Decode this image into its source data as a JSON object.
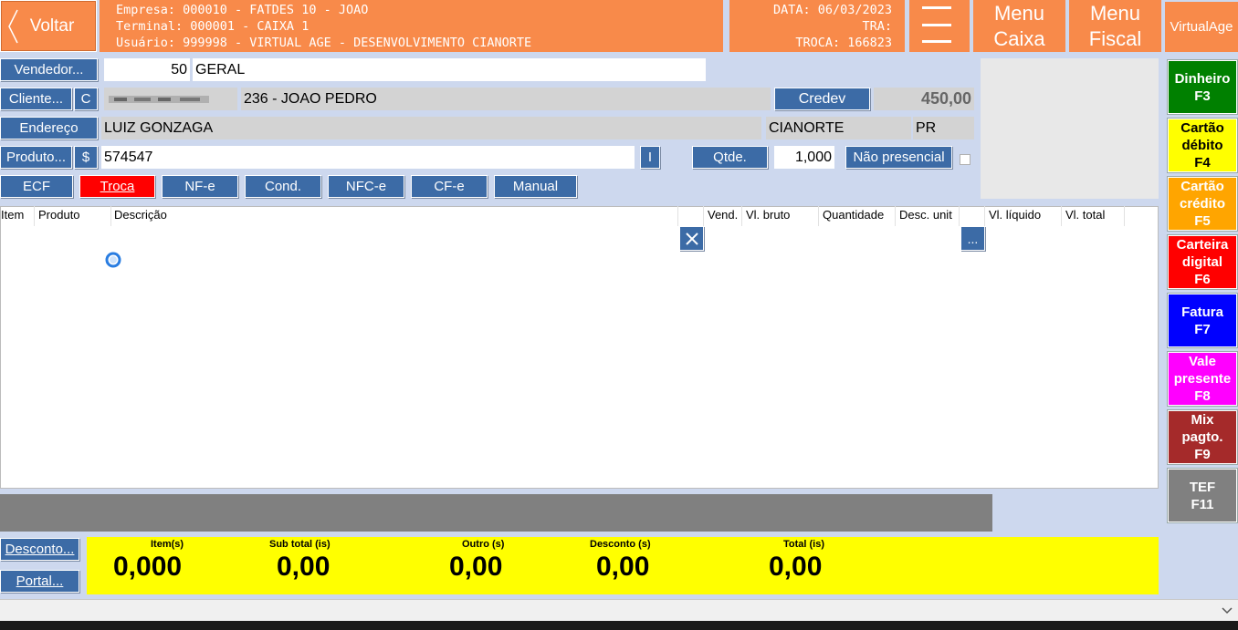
{
  "header": {
    "back_label": "Voltar",
    "empresa": "Empresa: 000010 - FATDES 10 - JOAO",
    "terminal": "Terminal: 000001 - CAIXA 1",
    "usuario": "Usuário: 999998 - VIRTUAL AGE - DESENVOLVIMENTO CIANORTE",
    "data": "DATA: 06/03/2023",
    "tra": "TRA:",
    "troca": "TROCA: 166823",
    "menu_caixa_1": "Menu",
    "menu_caixa_2": "Caixa",
    "menu_fiscal_1": "Menu",
    "menu_fiscal_2": "Fiscal",
    "virtualage": "VirtualAge"
  },
  "form": {
    "vendedor_label": "Vendedor...",
    "vendedor_code": "50",
    "vendedor_name": "GERAL",
    "cliente_label": "Cliente...",
    "cliente_c": "C",
    "cliente_name": "236 - JOAO PEDRO",
    "credev_label": "Credev",
    "credev_value": "450,00",
    "endereco_label": "Endereço",
    "endereco_value": "LUIZ GONZAGA",
    "cidade": "CIANORTE",
    "uf": "PR",
    "produto_label": "Produto...",
    "dollar": "$",
    "produto_value": "574547",
    "i_label": "I",
    "qtde_label": "Qtde.",
    "qtde_value": "1,000",
    "nao_presencial": "Não presencial"
  },
  "modes": [
    "ECF",
    "Troca",
    "NF-e",
    "Cond.",
    "NFC-e",
    "CF-e",
    "Manual"
  ],
  "table": {
    "columns": [
      "Item",
      "Produto",
      "Descrição",
      "Vend.",
      "Vl. bruto",
      "Quantidade",
      "Desc. unit",
      "Vl. líquido",
      "Vl. total"
    ],
    "more": "..."
  },
  "payments": [
    {
      "label": "Dinheiro\nF3",
      "bg": "#008000",
      "fg": "#ffffff"
    },
    {
      "label": "Cartão\ndébito\nF4",
      "bg": "#ffff00",
      "fg": "#000000"
    },
    {
      "label": "Cartão\ncrédito\nF5",
      "bg": "#ffa500",
      "fg": "#ffffff"
    },
    {
      "label": "Carteira\ndigital\nF6",
      "bg": "#ff0000",
      "fg": "#ffffff"
    },
    {
      "label": "Fatura\nF7",
      "bg": "#0000ff",
      "fg": "#ffffff"
    },
    {
      "label": "Vale\npresente\nF8",
      "bg": "#ff00ff",
      "fg": "#ffffff"
    },
    {
      "label": "Mix\npagto.\nF9",
      "bg": "#a52a2a",
      "fg": "#ffffff"
    },
    {
      "label": "TEF\nF11",
      "bg": "#808080",
      "fg": "#ffffff"
    }
  ],
  "footer": {
    "desconto_label": "Desconto...",
    "portal_label": "Portal...",
    "itens_label": "Item(s)",
    "itens_value": "0,000",
    "subtotal_label": "Sub total (is)",
    "subtotal_value": "0,00",
    "outro_label": "Outro (s)",
    "outro_value": "0,00",
    "desconto_tot_label": "Desconto (s)",
    "desconto_tot_value": "0,00",
    "total_label": "Total (is)",
    "total_value": "0,00"
  },
  "colors": {
    "header_orange": "#f88a4a",
    "button_blue": "#3c6ba6",
    "troca_red": "#ff0000",
    "totals_yellow": "#ffff00",
    "background": "#cdd8ee"
  }
}
